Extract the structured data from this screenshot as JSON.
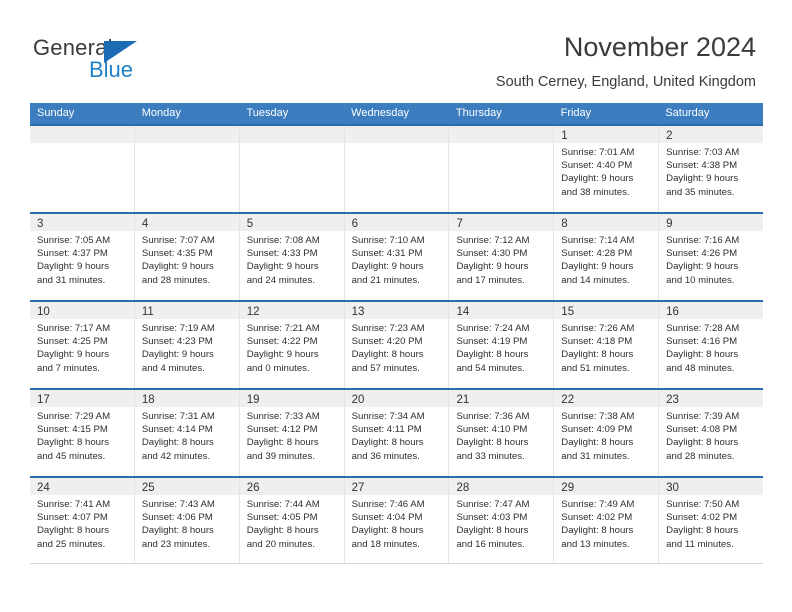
{
  "brand": {
    "name_part1": "General",
    "name_part2": "Blue"
  },
  "header": {
    "title": "November 2024",
    "location": "South Cerney, England, United Kingdom"
  },
  "colors": {
    "header_blue": "#3b7dbf",
    "rule_blue": "#2c6cab",
    "day_band_gray": "#efefef",
    "brand_blue": "#2081c9"
  },
  "calendar": {
    "weekday_headers": [
      "Sunday",
      "Monday",
      "Tuesday",
      "Wednesday",
      "Thursday",
      "Friday",
      "Saturday"
    ],
    "weeks": [
      [
        {
          "day": "",
          "empty": true
        },
        {
          "day": "",
          "empty": true
        },
        {
          "day": "",
          "empty": true
        },
        {
          "day": "",
          "empty": true
        },
        {
          "day": "",
          "empty": true
        },
        {
          "day": "1",
          "sunrise": "Sunrise: 7:01 AM",
          "sunset": "Sunset: 4:40 PM",
          "daylight_line1": "Daylight: 9 hours",
          "daylight_line2": "and 38 minutes."
        },
        {
          "day": "2",
          "sunrise": "Sunrise: 7:03 AM",
          "sunset": "Sunset: 4:38 PM",
          "daylight_line1": "Daylight: 9 hours",
          "daylight_line2": "and 35 minutes."
        }
      ],
      [
        {
          "day": "3",
          "sunrise": "Sunrise: 7:05 AM",
          "sunset": "Sunset: 4:37 PM",
          "daylight_line1": "Daylight: 9 hours",
          "daylight_line2": "and 31 minutes."
        },
        {
          "day": "4",
          "sunrise": "Sunrise: 7:07 AM",
          "sunset": "Sunset: 4:35 PM",
          "daylight_line1": "Daylight: 9 hours",
          "daylight_line2": "and 28 minutes."
        },
        {
          "day": "5",
          "sunrise": "Sunrise: 7:08 AM",
          "sunset": "Sunset: 4:33 PM",
          "daylight_line1": "Daylight: 9 hours",
          "daylight_line2": "and 24 minutes."
        },
        {
          "day": "6",
          "sunrise": "Sunrise: 7:10 AM",
          "sunset": "Sunset: 4:31 PM",
          "daylight_line1": "Daylight: 9 hours",
          "daylight_line2": "and 21 minutes."
        },
        {
          "day": "7",
          "sunrise": "Sunrise: 7:12 AM",
          "sunset": "Sunset: 4:30 PM",
          "daylight_line1": "Daylight: 9 hours",
          "daylight_line2": "and 17 minutes."
        },
        {
          "day": "8",
          "sunrise": "Sunrise: 7:14 AM",
          "sunset": "Sunset: 4:28 PM",
          "daylight_line1": "Daylight: 9 hours",
          "daylight_line2": "and 14 minutes."
        },
        {
          "day": "9",
          "sunrise": "Sunrise: 7:16 AM",
          "sunset": "Sunset: 4:26 PM",
          "daylight_line1": "Daylight: 9 hours",
          "daylight_line2": "and 10 minutes."
        }
      ],
      [
        {
          "day": "10",
          "sunrise": "Sunrise: 7:17 AM",
          "sunset": "Sunset: 4:25 PM",
          "daylight_line1": "Daylight: 9 hours",
          "daylight_line2": "and 7 minutes."
        },
        {
          "day": "11",
          "sunrise": "Sunrise: 7:19 AM",
          "sunset": "Sunset: 4:23 PM",
          "daylight_line1": "Daylight: 9 hours",
          "daylight_line2": "and 4 minutes."
        },
        {
          "day": "12",
          "sunrise": "Sunrise: 7:21 AM",
          "sunset": "Sunset: 4:22 PM",
          "daylight_line1": "Daylight: 9 hours",
          "daylight_line2": "and 0 minutes."
        },
        {
          "day": "13",
          "sunrise": "Sunrise: 7:23 AM",
          "sunset": "Sunset: 4:20 PM",
          "daylight_line1": "Daylight: 8 hours",
          "daylight_line2": "and 57 minutes."
        },
        {
          "day": "14",
          "sunrise": "Sunrise: 7:24 AM",
          "sunset": "Sunset: 4:19 PM",
          "daylight_line1": "Daylight: 8 hours",
          "daylight_line2": "and 54 minutes."
        },
        {
          "day": "15",
          "sunrise": "Sunrise: 7:26 AM",
          "sunset": "Sunset: 4:18 PM",
          "daylight_line1": "Daylight: 8 hours",
          "daylight_line2": "and 51 minutes."
        },
        {
          "day": "16",
          "sunrise": "Sunrise: 7:28 AM",
          "sunset": "Sunset: 4:16 PM",
          "daylight_line1": "Daylight: 8 hours",
          "daylight_line2": "and 48 minutes."
        }
      ],
      [
        {
          "day": "17",
          "sunrise": "Sunrise: 7:29 AM",
          "sunset": "Sunset: 4:15 PM",
          "daylight_line1": "Daylight: 8 hours",
          "daylight_line2": "and 45 minutes."
        },
        {
          "day": "18",
          "sunrise": "Sunrise: 7:31 AM",
          "sunset": "Sunset: 4:14 PM",
          "daylight_line1": "Daylight: 8 hours",
          "daylight_line2": "and 42 minutes."
        },
        {
          "day": "19",
          "sunrise": "Sunrise: 7:33 AM",
          "sunset": "Sunset: 4:12 PM",
          "daylight_line1": "Daylight: 8 hours",
          "daylight_line2": "and 39 minutes."
        },
        {
          "day": "20",
          "sunrise": "Sunrise: 7:34 AM",
          "sunset": "Sunset: 4:11 PM",
          "daylight_line1": "Daylight: 8 hours",
          "daylight_line2": "and 36 minutes."
        },
        {
          "day": "21",
          "sunrise": "Sunrise: 7:36 AM",
          "sunset": "Sunset: 4:10 PM",
          "daylight_line1": "Daylight: 8 hours",
          "daylight_line2": "and 33 minutes."
        },
        {
          "day": "22",
          "sunrise": "Sunrise: 7:38 AM",
          "sunset": "Sunset: 4:09 PM",
          "daylight_line1": "Daylight: 8 hours",
          "daylight_line2": "and 31 minutes."
        },
        {
          "day": "23",
          "sunrise": "Sunrise: 7:39 AM",
          "sunset": "Sunset: 4:08 PM",
          "daylight_line1": "Daylight: 8 hours",
          "daylight_line2": "and 28 minutes."
        }
      ],
      [
        {
          "day": "24",
          "sunrise": "Sunrise: 7:41 AM",
          "sunset": "Sunset: 4:07 PM",
          "daylight_line1": "Daylight: 8 hours",
          "daylight_line2": "and 25 minutes."
        },
        {
          "day": "25",
          "sunrise": "Sunrise: 7:43 AM",
          "sunset": "Sunset: 4:06 PM",
          "daylight_line1": "Daylight: 8 hours",
          "daylight_line2": "and 23 minutes."
        },
        {
          "day": "26",
          "sunrise": "Sunrise: 7:44 AM",
          "sunset": "Sunset: 4:05 PM",
          "daylight_line1": "Daylight: 8 hours",
          "daylight_line2": "and 20 minutes."
        },
        {
          "day": "27",
          "sunrise": "Sunrise: 7:46 AM",
          "sunset": "Sunset: 4:04 PM",
          "daylight_line1": "Daylight: 8 hours",
          "daylight_line2": "and 18 minutes."
        },
        {
          "day": "28",
          "sunrise": "Sunrise: 7:47 AM",
          "sunset": "Sunset: 4:03 PM",
          "daylight_line1": "Daylight: 8 hours",
          "daylight_line2": "and 16 minutes."
        },
        {
          "day": "29",
          "sunrise": "Sunrise: 7:49 AM",
          "sunset": "Sunset: 4:02 PM",
          "daylight_line1": "Daylight: 8 hours",
          "daylight_line2": "and 13 minutes."
        },
        {
          "day": "30",
          "sunrise": "Sunrise: 7:50 AM",
          "sunset": "Sunset: 4:02 PM",
          "daylight_line1": "Daylight: 8 hours",
          "daylight_line2": "and 11 minutes."
        }
      ]
    ]
  }
}
